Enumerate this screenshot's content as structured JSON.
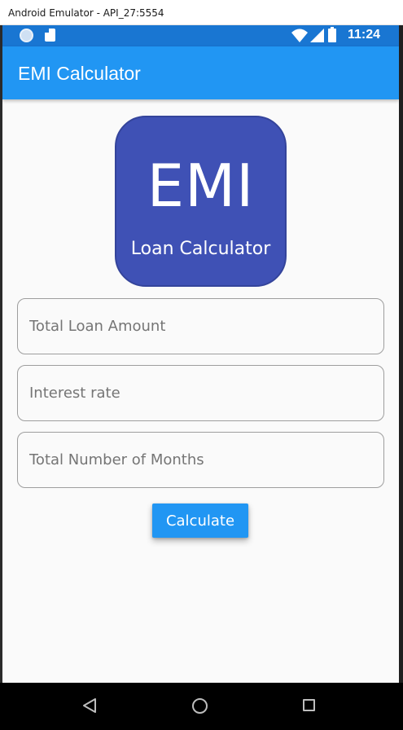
{
  "window": {
    "title": "Android Emulator - API_27:5554"
  },
  "status_bar": {
    "time": "11:24",
    "icons": [
      "record-icon",
      "sd-card-icon",
      "wifi-icon",
      "signal-icon",
      "battery-icon"
    ],
    "color": "#1976d2"
  },
  "app_bar": {
    "title": "EMI Calculator",
    "color": "#2196f3"
  },
  "logo": {
    "main_text": "EMI",
    "sub_text": "Loan Calculator",
    "color": "#3f51b5"
  },
  "form": {
    "loan_amount": {
      "value": "",
      "placeholder": "Total Loan Amount"
    },
    "interest_rate": {
      "value": "",
      "placeholder": "Interest rate"
    },
    "months": {
      "value": "",
      "placeholder": "Total Number of Months"
    },
    "calculate_label": "Calculate"
  },
  "nav_bar": {
    "icons": [
      "back-icon",
      "home-icon",
      "recent-apps-icon"
    ]
  }
}
